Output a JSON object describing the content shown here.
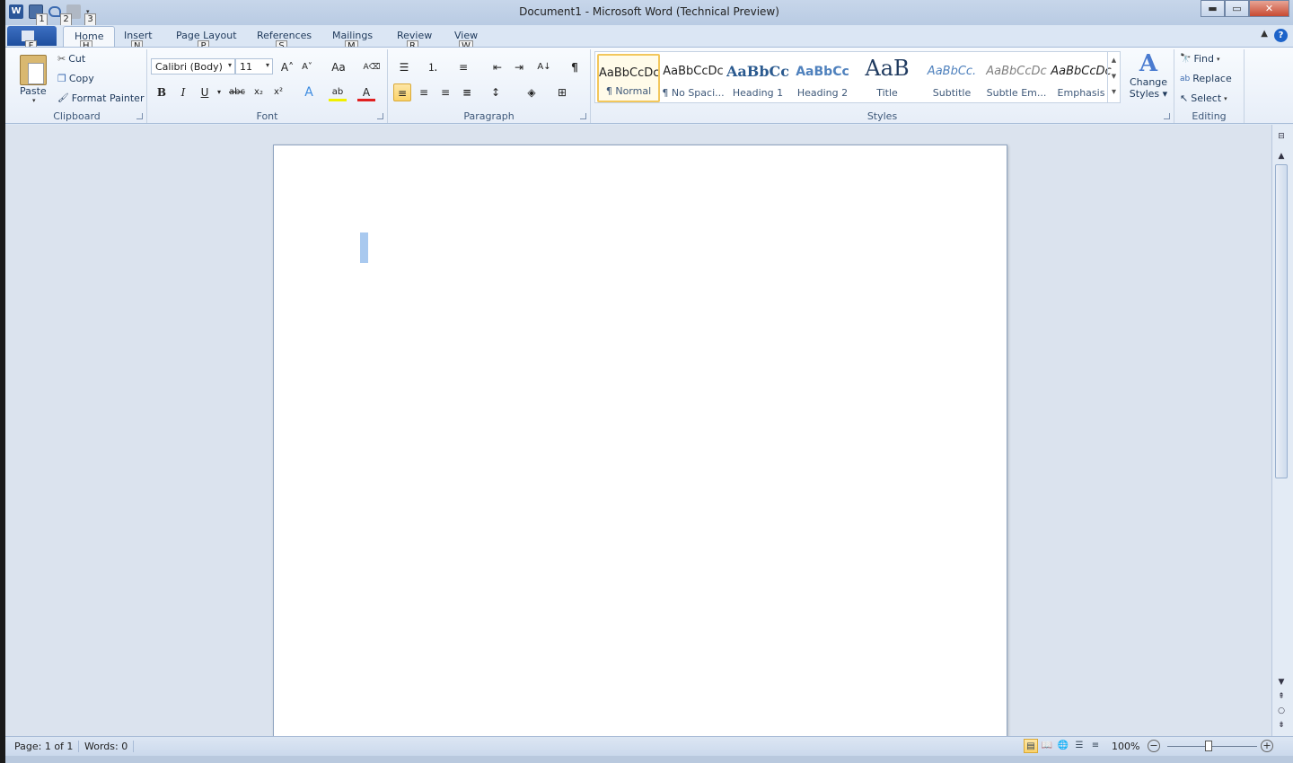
{
  "window": {
    "title": "Document1  -  Microsoft Word (Technical Preview)",
    "controls": {
      "minimize": "▬",
      "maximize": "▭",
      "close": "✕"
    }
  },
  "qat": {
    "keytips": [
      "1",
      "2",
      "3"
    ],
    "icons": [
      "word-logo-icon",
      "save-icon",
      "undo-icon",
      "redo-icon",
      "customize-qat-icon"
    ],
    "word_logo_glyph": "W",
    "customize_glyph": "▾"
  },
  "tabs": {
    "file_keytip": "F",
    "items": [
      {
        "label": "Home",
        "keytip": "H"
      },
      {
        "label": "Insert",
        "keytip": "N"
      },
      {
        "label": "Page Layout",
        "keytip": "P"
      },
      {
        "label": "References",
        "keytip": "S"
      },
      {
        "label": "Mailings",
        "keytip": "M"
      },
      {
        "label": "Review",
        "keytip": "R"
      },
      {
        "label": "View",
        "keytip": "W"
      }
    ],
    "collapse_glyph": "▲",
    "help_glyph": "?"
  },
  "clipboard": {
    "label": "Clipboard",
    "paste": "Paste",
    "cut": "Cut",
    "copy": "Copy",
    "format_painter": "Format Painter",
    "glyphs": {
      "cut": "✂",
      "copy": "❐",
      "format_painter": "🖌",
      "caret": "▾"
    }
  },
  "font": {
    "label": "Font",
    "family": "Calibri (Body)",
    "size": "11",
    "glyphs": {
      "grow": "A˄",
      "shrink": "A˅",
      "case": "Aa",
      "clear": "A⌫",
      "bold": "B",
      "italic": "I",
      "underline": "U",
      "strike": "abc",
      "subscript": "x₂",
      "superscript": "x²",
      "effects": "A",
      "highlight": "ab",
      "color": "A",
      "dropdown": "▾"
    }
  },
  "paragraph": {
    "label": "Paragraph",
    "glyphs": {
      "bullets": "☰",
      "numbering": "⒈",
      "multilevel": "≡",
      "decrease_indent": "⇤",
      "increase_indent": "⇥",
      "sort": "A↓",
      "show_marks": "¶",
      "align_left": "≡",
      "center": "≡",
      "align_right": "≡",
      "justify": "≡",
      "line_spacing": "↕",
      "shading": "◈",
      "borders": "⊞",
      "dropdown": "▾"
    }
  },
  "styles": {
    "label": "Styles",
    "items": [
      {
        "preview": "AaBbCcDc",
        "name": "¶ Normal",
        "selected": true
      },
      {
        "preview": "AaBbCcDc",
        "name": "¶ No Spaci..."
      },
      {
        "preview": "AaBbCc",
        "name": "Heading 1"
      },
      {
        "preview": "AaBbCc",
        "name": "Heading 2"
      },
      {
        "preview": "AaB",
        "name": "Title"
      },
      {
        "preview": "AaBbCc.",
        "name": "Subtitle"
      },
      {
        "preview": "AaBbCcDc",
        "name": "Subtle Em..."
      },
      {
        "preview": "AaBbCcDc",
        "name": "Emphasis"
      }
    ],
    "change_styles": "Change Styles",
    "change_styles_line1": "Change",
    "change_styles_line2": "Styles ▾",
    "scroll_glyphs": {
      "up": "▲",
      "down": "▼",
      "more": "▾"
    }
  },
  "editing": {
    "label": "Editing",
    "find": "Find",
    "replace": "Replace",
    "select": "Select",
    "glyphs": {
      "find": "🔭",
      "replace": "ab",
      "select": "↖",
      "caret": "▾"
    }
  },
  "scrollbar": {
    "up": "▲",
    "down": "▼",
    "prev": "⇞",
    "browse": "○",
    "next": "⇟",
    "ruler_toggle": "⊟"
  },
  "status": {
    "page": "Page: 1 of 1",
    "words": "Words: 0",
    "zoom": "100%",
    "zoom_level": 1.0,
    "zoom_minus": "−",
    "zoom_plus": "+",
    "view_glyphs": [
      "▤",
      "📖",
      "🌐",
      "☰",
      "≡"
    ]
  }
}
